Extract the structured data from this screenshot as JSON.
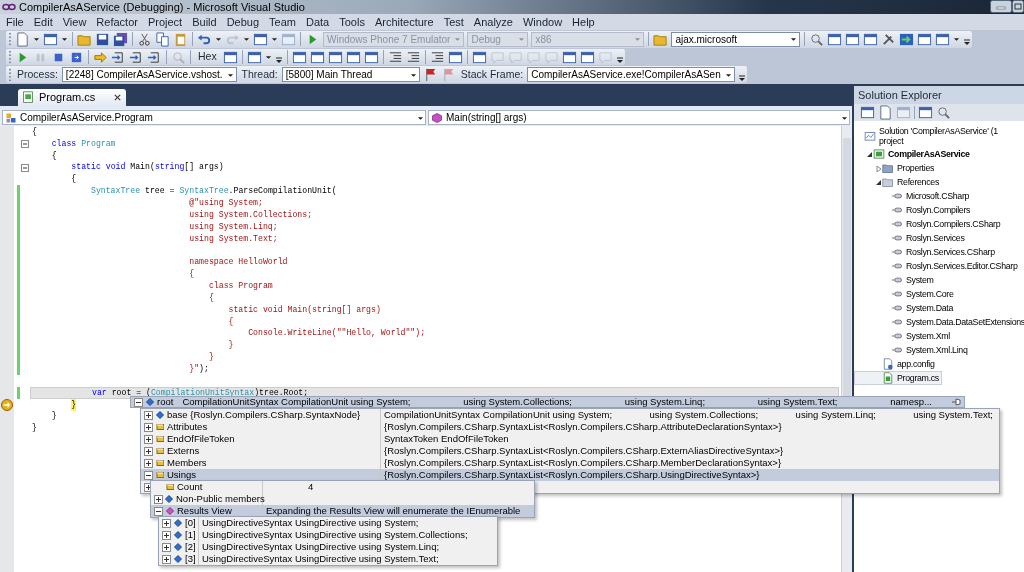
{
  "window": {
    "title": "CompilerAsAService (Debugging) - Microsoft Visual Studio"
  },
  "menu": [
    "File",
    "Edit",
    "View",
    "Refactor",
    "Project",
    "Build",
    "Debug",
    "Team",
    "Data",
    "Tools",
    "Architecture",
    "Test",
    "Analyze",
    "Window",
    "Help"
  ],
  "standard_toolbar": {
    "combos": [
      {
        "text": "Windows Phone 7 Emulator",
        "disabled": true
      },
      {
        "text": "Debug",
        "disabled": true
      },
      {
        "text": "x86",
        "disabled": true
      },
      {
        "text": "ajax.microsoft",
        "disabled": false
      }
    ]
  },
  "debug_toolbar": {
    "hex": "Hex"
  },
  "debug_location_toolbar": {
    "fields": [
      {
        "label": "Process:",
        "value": "[2248] CompilerAsAService.vshost."
      },
      {
        "label": "Thread:",
        "value": "[5800] Main Thread"
      },
      {
        "label": "Stack Frame:",
        "value": "CompilerAsAService.exe!CompilerAsASen"
      }
    ]
  },
  "document_tabs": [
    {
      "label": "Program.cs",
      "selected": true
    }
  ],
  "editor": {
    "type_dropdown": "CompilerAsAService.Program",
    "member_dropdown": "Main(string[] args)",
    "lines": [
      {
        "tokens": [
          {
            "text": "{",
            "kind": "plain"
          }
        ],
        "changed": false,
        "fold": false,
        "selected": false,
        "current": false
      },
      {
        "tokens": [
          {
            "text": "    class ",
            "kind": "keyword"
          },
          {
            "text": "Program",
            "kind": "type"
          }
        ],
        "changed": false,
        "fold": true,
        "selected": false,
        "current": false
      },
      {
        "tokens": [
          {
            "text": "    {",
            "kind": "plain"
          }
        ],
        "changed": false,
        "fold": false,
        "selected": false,
        "current": false
      },
      {
        "tokens": [
          {
            "text": "        static ",
            "kind": "keyword"
          },
          {
            "text": "void",
            "kind": "keyword"
          },
          {
            "text": " Main(",
            "kind": "plain"
          },
          {
            "text": "string",
            "kind": "keyword"
          },
          {
            "text": "[] args)",
            "kind": "plain"
          }
        ],
        "changed": false,
        "fold": true,
        "selected": false,
        "current": false
      },
      {
        "tokens": [
          {
            "text": "        {",
            "kind": "plain"
          }
        ],
        "changed": false,
        "fold": false,
        "selected": false,
        "current": false
      },
      {
        "tokens": [
          {
            "text": "            SyntaxTree",
            "kind": "type"
          },
          {
            "text": " tree = ",
            "kind": "plain"
          },
          {
            "text": "SyntaxTree",
            "kind": "type"
          },
          {
            "text": ".ParseCompilationUnit(",
            "kind": "plain"
          }
        ],
        "changed": true,
        "fold": false,
        "selected": false,
        "current": false
      },
      {
        "tokens": [
          {
            "text": "                                @\"using System;",
            "kind": "string"
          }
        ],
        "changed": true,
        "fold": false,
        "selected": false,
        "current": false
      },
      {
        "tokens": [
          {
            "text": "                                using System.Collections;",
            "kind": "string"
          }
        ],
        "changed": true,
        "fold": false,
        "selected": false,
        "current": false
      },
      {
        "tokens": [
          {
            "text": "                                using System.Linq;",
            "kind": "string"
          }
        ],
        "changed": true,
        "fold": false,
        "selected": false,
        "current": false
      },
      {
        "tokens": [
          {
            "text": "                                using System.Text;",
            "kind": "string"
          }
        ],
        "changed": true,
        "fold": false,
        "selected": false,
        "current": false
      },
      {
        "changed": true,
        "fold": false,
        "selected": false,
        "current": false
      },
      {
        "tokens": [
          {
            "text": "                                namespace HelloWorld",
            "kind": "string"
          }
        ],
        "changed": true,
        "fold": false,
        "selected": false,
        "current": false
      },
      {
        "tokens": [
          {
            "text": "                                {",
            "kind": "string"
          }
        ],
        "changed": true,
        "fold": false,
        "selected": false,
        "current": false
      },
      {
        "tokens": [
          {
            "text": "                                    class Program",
            "kind": "string"
          }
        ],
        "changed": true,
        "fold": false,
        "selected": false,
        "current": false
      },
      {
        "tokens": [
          {
            "text": "                                    {",
            "kind": "string"
          }
        ],
        "changed": true,
        "fold": false,
        "selected": false,
        "current": false
      },
      {
        "tokens": [
          {
            "text": "                                        static void Main(string[] args)",
            "kind": "string"
          }
        ],
        "changed": true,
        "fold": false,
        "selected": false,
        "current": false
      },
      {
        "tokens": [
          {
            "text": "                                        {",
            "kind": "string"
          }
        ],
        "changed": true,
        "fold": false,
        "selected": false,
        "current": false
      },
      {
        "tokens": [
          {
            "text": "                                            Console.WriteLine(\"\"Hello, World\"\");",
            "kind": "string"
          }
        ],
        "changed": true,
        "fold": false,
        "selected": false,
        "current": false
      },
      {
        "tokens": [
          {
            "text": "                                        }",
            "kind": "string"
          }
        ],
        "changed": true,
        "fold": false,
        "selected": false,
        "current": false
      },
      {
        "tokens": [
          {
            "text": "                                    }",
            "kind": "string"
          }
        ],
        "changed": true,
        "fold": false,
        "selected": false,
        "current": false
      },
      {
        "tokens": [
          {
            "text": "                                }\"",
            "kind": "string"
          },
          {
            "text": ");",
            "kind": "plain"
          }
        ],
        "changed": true,
        "fold": false,
        "selected": false,
        "current": false
      },
      {
        "changed": false,
        "fold": false,
        "selected": false,
        "current": false
      },
      {
        "tokens": [
          {
            "text": "            var",
            "kind": "keyword"
          },
          {
            "text": " root = (",
            "kind": "plain"
          },
          {
            "text": "CompilationUnitSyntax",
            "kind": "type"
          },
          {
            "text": ")tree.Root;",
            "kind": "plain"
          }
        ],
        "changed": true,
        "fold": false,
        "selected": true,
        "current": false
      },
      {
        "tokens": [
          {
            "text": "        }",
            "kind": "plain"
          }
        ],
        "changed": false,
        "fold": false,
        "selected": false,
        "current": true
      },
      {
        "tokens": [
          {
            "text": "    }",
            "kind": "plain"
          }
        ],
        "changed": false,
        "fold": false,
        "selected": false,
        "current": false
      },
      {
        "tokens": [
          {
            "text": "}",
            "kind": "plain"
          }
        ],
        "changed": false,
        "fold": false,
        "selected": false,
        "current": false
      }
    ]
  },
  "datatip": {
    "root": {
      "name": "root",
      "kind": "field",
      "expanded": true,
      "value_parts": [
        "CompilationUnitSyntax CompilationUnit using System;",
        "using System.Collections;",
        "using System.Linq;",
        "using System.Text;",
        "namesp..."
      ]
    },
    "members": [
      {
        "name": "base {Roslyn.Compilers.CSharp.SyntaxNode}",
        "kind": "field",
        "expanded": false,
        "selected": false,
        "value_parts": [
          "CompilationUnitSyntax CompilationUnit using System;",
          "using System.Collections;",
          "using System.Linq;",
          "using System.Text;"
        ]
      },
      {
        "name": "Attributes",
        "kind": "property",
        "expanded": false,
        "selected": false,
        "value_parts": [
          "{Roslyn.Compilers.CSharp.SyntaxList<Roslyn.Compilers.CSharp.AttributeDeclarationSyntax>}"
        ]
      },
      {
        "name": "EndOfFileToken",
        "kind": "property",
        "expanded": false,
        "selected": false,
        "value_parts": [
          "SyntaxToken EndOfFileToken"
        ]
      },
      {
        "name": "Externs",
        "kind": "property",
        "expanded": false,
        "selected": false,
        "value_parts": [
          "{Roslyn.Compilers.CSharp.SyntaxList<Roslyn.Compilers.CSharp.ExternAliasDirectiveSyntax>}"
        ]
      },
      {
        "name": "Members",
        "kind": "property",
        "expanded": false,
        "selected": false,
        "value_parts": [
          "{Roslyn.Compilers.CSharp.SyntaxList<Roslyn.Compilers.CSharp.MemberDeclarationSyntax>}"
        ]
      },
      {
        "name": "Usings",
        "kind": "property",
        "expanded": true,
        "selected": true,
        "value_parts": [
          "{Roslyn.Compilers.CSharp.SyntaxList<Roslyn.Compilers.CSharp.UsingDirectiveSyntax>}"
        ]
      },
      {
        "expanded": false,
        "selected": false
      }
    ],
    "usings_members": [
      {
        "name": "Count",
        "kind": "property",
        "selected": false,
        "value": "4"
      },
      {
        "name": "Non-Public members",
        "kind": "field",
        "expanded": false,
        "selected": false
      },
      {
        "name": "Results View",
        "kind": "view",
        "expanded": true,
        "selected": true,
        "value": "Expanding the Results View will enumerate the IEnumerable"
      }
    ],
    "results": [
      {
        "name": "[0]",
        "kind": "field",
        "expanded": false,
        "value": "UsingDirectiveSyntax UsingDirective using System;"
      },
      {
        "name": "[1]",
        "kind": "field",
        "expanded": false,
        "value": "UsingDirectiveSyntax UsingDirective using System.Collections;"
      },
      {
        "name": "[2]",
        "kind": "field",
        "expanded": false,
        "value": "UsingDirectiveSyntax UsingDirective using System.Linq;"
      },
      {
        "name": "[3]",
        "kind": "field",
        "expanded": false,
        "value": "UsingDirectiveSyntax UsingDirective using System.Text;"
      }
    ]
  },
  "solution_explorer": {
    "title": "Solution Explorer",
    "tree": [
      {
        "label": "Solution 'CompilerAsAService' (1 project",
        "kind": "solution",
        "selected": false,
        "children": [
          {
            "label": "CompilerAsAService",
            "kind": "project",
            "expanded": true,
            "selected": false,
            "children": [
              {
                "label": "Properties",
                "kind": "properties",
                "expanded": false,
                "selected": false
              },
              {
                "label": "References",
                "kind": "references",
                "expanded": true,
                "selected": false,
                "children": [
                  {
                    "label": "Microsoft.CSharp",
                    "kind": "reference",
                    "selected": false
                  },
                  {
                    "label": "Roslyn.Compilers",
                    "kind": "reference",
                    "selected": false
                  },
                  {
                    "label": "Roslyn.Compilers.CSharp",
                    "kind": "reference",
                    "selected": false
                  },
                  {
                    "label": "Roslyn.Services",
                    "kind": "reference",
                    "selected": false
                  },
                  {
                    "label": "Roslyn.Services.CSharp",
                    "kind": "reference",
                    "selected": false
                  },
                  {
                    "label": "Roslyn.Services.Editor.CSharp",
                    "kind": "reference",
                    "selected": false
                  },
                  {
                    "label": "System",
                    "kind": "reference",
                    "selected": false
                  },
                  {
                    "label": "System.Core",
                    "kind": "reference",
                    "selected": false
                  },
                  {
                    "label": "System.Data",
                    "kind": "reference",
                    "selected": false
                  },
                  {
                    "label": "System.Data.DataSetExtensions",
                    "kind": "reference",
                    "selected": false
                  },
                  {
                    "label": "System.Xml",
                    "kind": "reference",
                    "selected": false
                  },
                  {
                    "label": "System.Xml.Linq",
                    "kind": "reference",
                    "selected": false
                  }
                ]
              },
              {
                "label": "app.config",
                "kind": "config",
                "selected": false
              },
              {
                "label": "Program.cs",
                "kind": "code",
                "selected": true
              }
            ]
          }
        ]
      }
    ]
  }
}
